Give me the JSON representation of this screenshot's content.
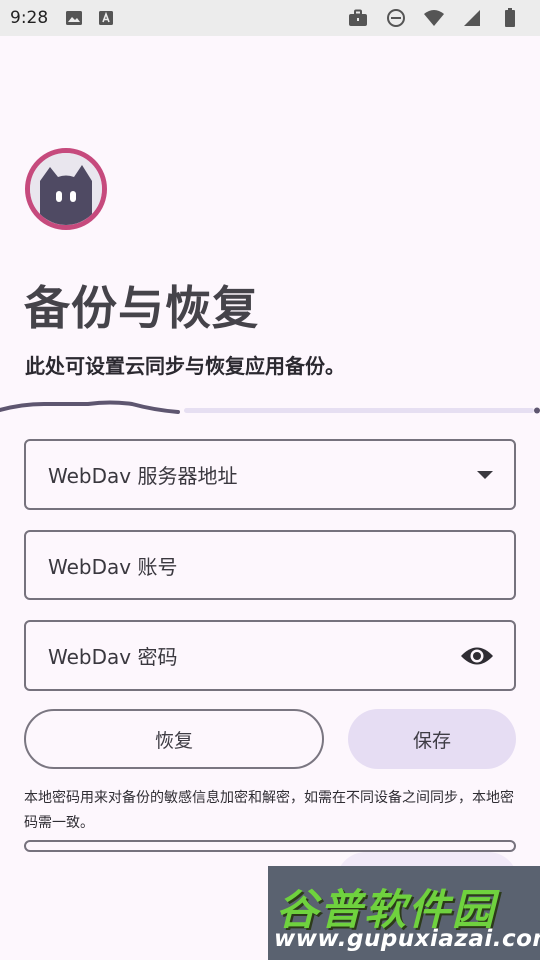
{
  "status_bar": {
    "time": "9:28",
    "left_icons": [
      "image-icon",
      "font-a-icon"
    ],
    "right_icons": [
      "briefcase-icon",
      "do-not-disturb-icon",
      "wifi-icon",
      "signal-icon",
      "battery-icon"
    ]
  },
  "page": {
    "title": "备份与恢复",
    "subtitle": "此处可设置云同步与恢复应用备份。"
  },
  "progress": {
    "value": 0.33
  },
  "form": {
    "server_label": "WebDav 服务器地址",
    "account_label": "WebDav 账号",
    "password_label": "WebDav 密码"
  },
  "actions": {
    "restore_label": "恢复",
    "save_label": "保存"
  },
  "note": "本地密码用来对备份的敏感信息加密和解密，如需在不同设备之间同步，本地密码需一致。",
  "watermark": {
    "brand": "谷普软件园",
    "url": "www.gupuxiazai.com"
  },
  "colors": {
    "background": "#fdf7fd",
    "accent": "#c64a7d",
    "tonal": "#e6ddf3",
    "outline": "#76727d"
  }
}
